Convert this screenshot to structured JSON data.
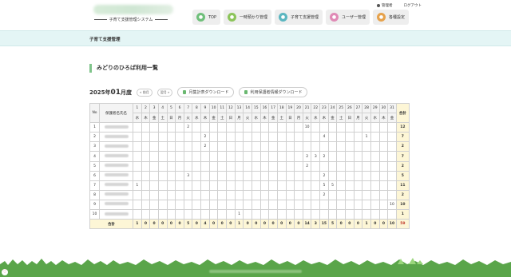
{
  "header": {
    "system_name": "子育て支援管理システム",
    "links": [
      "管理者",
      "ログアウト"
    ]
  },
  "nav": [
    {
      "label": "TOP",
      "icon": "home-icon",
      "color": "#6fbf7a"
    },
    {
      "label": "一時預かり管理",
      "icon": "child-icon",
      "color": "#8cc45a"
    },
    {
      "label": "子育て支援管理",
      "icon": "support-icon",
      "color": "#5bb6c0"
    },
    {
      "label": "ユーザー管理",
      "icon": "user-icon",
      "color": "#e08ab6"
    },
    {
      "label": "各種設定",
      "icon": "gear-icon",
      "color": "#e6a24c"
    }
  ],
  "band_title": "子育て支援管理",
  "section_title": "みどりのひろば利用一覧",
  "controls": {
    "year": "2025年",
    "month": "01",
    "month_suffix": "月度",
    "prev": "前月",
    "next": "翌月",
    "download_monthly": "月集計表ダウンロード",
    "download_guardian": "利用保護者情報ダウンロード"
  },
  "table": {
    "header_no": "No",
    "header_name": "保護者名氏名",
    "header_total": "合計",
    "days": [
      "1",
      "2",
      "3",
      "4",
      "5",
      "6",
      "7",
      "8",
      "9",
      "10",
      "11",
      "12",
      "13",
      "14",
      "15",
      "16",
      "17",
      "18",
      "19",
      "20",
      "21",
      "22",
      "23",
      "24",
      "25",
      "26",
      "27",
      "28",
      "29",
      "30",
      "31"
    ],
    "weekdays": [
      "水",
      "木",
      "金",
      "土",
      "日",
      "月",
      "火",
      "水",
      "木",
      "金",
      "土",
      "日",
      "月",
      "火",
      "水",
      "木",
      "金",
      "土",
      "日",
      "月",
      "火",
      "水",
      "木",
      "金",
      "土",
      "日",
      "月",
      "火",
      "水",
      "木",
      "金"
    ],
    "rows": [
      {
        "no": "1",
        "cells": {
          "7": "2",
          "21": "10"
        },
        "total": "12"
      },
      {
        "no": "2",
        "cells": {
          "9": "2",
          "23": "4",
          "28": "1"
        },
        "total": "7"
      },
      {
        "no": "3",
        "cells": {
          "9": "2"
        },
        "total": "2"
      },
      {
        "no": "4",
        "cells": {
          "21": "2",
          "22": "3",
          "23": "2"
        },
        "total": "7"
      },
      {
        "no": "5",
        "cells": {
          "21": "2"
        },
        "total": "2"
      },
      {
        "no": "6",
        "cells": {
          "7": "3",
          "23": "2"
        },
        "total": "5"
      },
      {
        "no": "7",
        "cells": {
          "1": "1",
          "23": "5",
          "24": "5"
        },
        "total": "11"
      },
      {
        "no": "8",
        "cells": {
          "23": "2"
        },
        "total": "2"
      },
      {
        "no": "9",
        "cells": {
          "31": "10"
        },
        "total": "10"
      },
      {
        "no": "10",
        "cells": {
          "13": "1"
        },
        "total": "1"
      }
    ],
    "sum_label": "合計",
    "sums": [
      "1",
      "0",
      "0",
      "0",
      "0",
      "0",
      "5",
      "0",
      "4",
      "0",
      "0",
      "0",
      "1",
      "0",
      "0",
      "0",
      "0",
      "0",
      "0",
      "0",
      "14",
      "3",
      "15",
      "5",
      "0",
      "0",
      "0",
      "1",
      "0",
      "0",
      "10"
    ],
    "grand_total": "59"
  }
}
